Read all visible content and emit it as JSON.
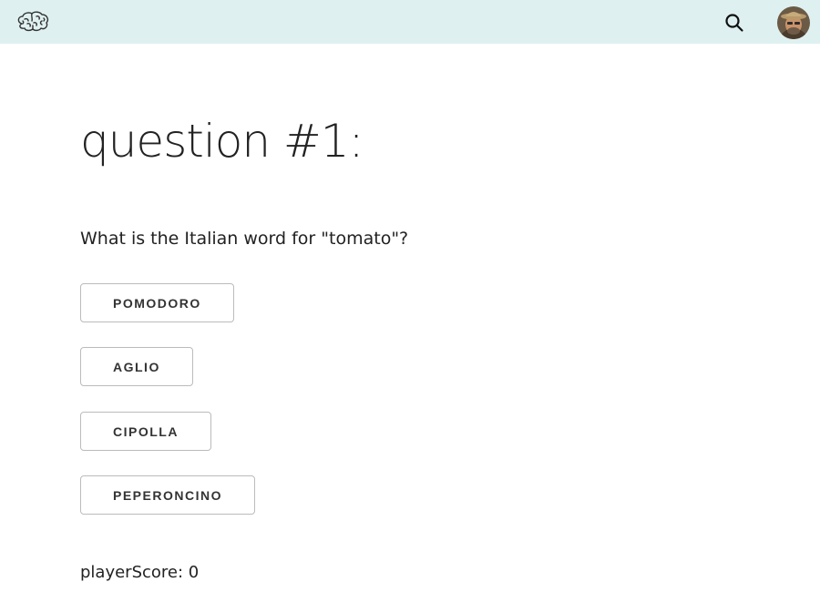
{
  "header": {
    "logo_icon": "brain-icon",
    "search_icon": "search-icon",
    "avatar_icon": "user-avatar",
    "background_color": "#dff0f0"
  },
  "quiz": {
    "heading": "question #1:",
    "question": "What is the Italian word for \"tomato\"?",
    "answers": [
      {
        "label": "POMODORO"
      },
      {
        "label": "AGLIO"
      },
      {
        "label": "CIPOLLA"
      },
      {
        "label": "PEPERONCINO"
      }
    ]
  },
  "score": {
    "text": "playerScore: 0"
  }
}
